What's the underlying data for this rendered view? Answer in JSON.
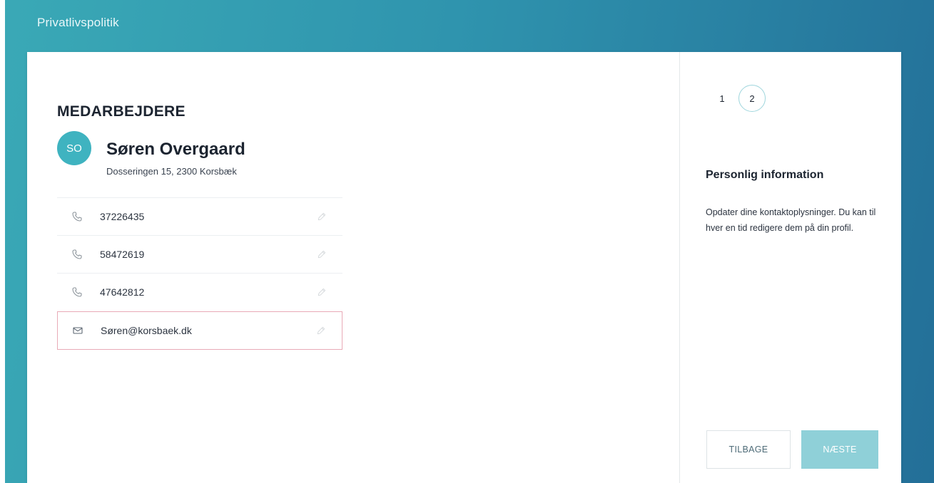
{
  "app": {
    "title": "Privatlivspolitik"
  },
  "main": {
    "heading": "MEDARBEJDERE",
    "person": {
      "initials": "SO",
      "name": "Søren Overgaard",
      "address": "Dosseringen 15, 2300 Korsbæk"
    },
    "contacts": [
      {
        "type": "phone",
        "icon": "phone-icon",
        "value": "37226435"
      },
      {
        "type": "phone",
        "icon": "phone-icon",
        "value": "58472619"
      },
      {
        "type": "phone",
        "icon": "phone-icon",
        "value": "47642812"
      },
      {
        "type": "email",
        "icon": "mail-icon",
        "value": "Søren@korsbaek.dk"
      }
    ]
  },
  "side": {
    "steps": [
      "1",
      "2"
    ],
    "current_step": "2",
    "title": "Personlig information",
    "description": "Opdater dine kontaktoplysninger. Du kan til hver en tid redigere dem på din profil.",
    "back_label": "TILBAGE",
    "next_label": "NÆSTE"
  },
  "colors": {
    "accent": "#3fb3c0",
    "highlight_border": "#e9aab7",
    "next_button": "#8fd0d8"
  }
}
